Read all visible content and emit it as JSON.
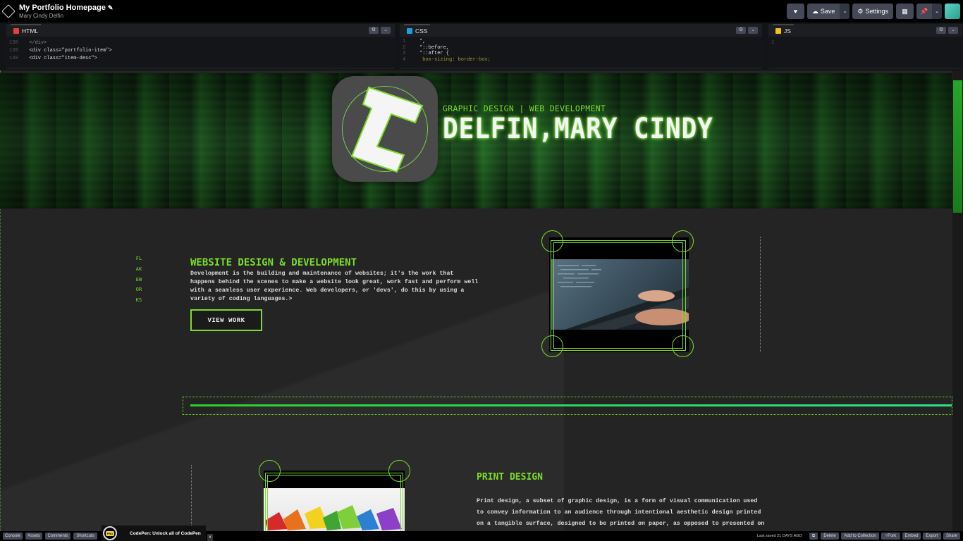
{
  "header": {
    "pen_title": "My Portfolio Homepage",
    "edit_icon": "pencil-icon",
    "author": "Mary Cindy Delfin",
    "buttons": {
      "heart_icon": "heart-icon",
      "save": "Save",
      "settings": "Settings"
    }
  },
  "editors": {
    "html": {
      "label": "HTML",
      "color": "#e5413a",
      "lines": [
        {
          "num": "138",
          "code": "      </div>"
        },
        {
          "num": "139",
          "code": "      <div class=\"portfolio-item\">"
        },
        {
          "num": "140",
          "code": "        <div class=\"item-desc\">"
        }
      ]
    },
    "css": {
      "label": "CSS",
      "color": "#1aa0e0",
      "lines": [
        {
          "num": "1",
          "code": "*,"
        },
        {
          "num": "2",
          "code": "*::before,"
        },
        {
          "num": "3",
          "code": "*::after {"
        },
        {
          "num": "4",
          "code": "  box-sizing: border-box;"
        }
      ]
    },
    "js": {
      "label": "JS",
      "color": "#f2c21b",
      "lines": [
        {
          "num": "1",
          "code": ""
        }
      ]
    }
  },
  "preview": {
    "subtitle": "GRAPHIC DESIGN | WEB DEVELOPMENT",
    "name": "DELFIN,MARY CINDY",
    "side_label": "FLAKEWORKS",
    "section1": {
      "title": "WEBSITE DESIGN & DEVELOPMENT",
      "body": "Development is the building and maintenance of websites; it's the work that happens behind the scenes to make a website look great, work fast and perform well with a seamless user experience. Web developers, or 'devs', do this by using a variety of coding languages.>",
      "button": "VIEW WORK"
    },
    "section2": {
      "title": "PRINT DESIGN",
      "body": "Print design, a subset of graphic design, is a form of visual communication used to convey information to an audience through intentional aesthetic design printed on a tangible surface, designed to be printed on paper, as opposed to presented on a"
    },
    "accent_color": "#7bdc2a"
  },
  "footer": {
    "left_buttons": [
      "Console",
      "Assets",
      "Comments",
      "Shortcuts"
    ],
    "promo": "CodePen: Unlock all of CodePen",
    "promo_badge": "PRO",
    "close": "x",
    "last_saved": "Last saved 21 DAYS AGO",
    "right_buttons": [
      "Delete",
      "Add to Collection",
      "Fork",
      "Embed",
      "Export",
      "Share"
    ]
  }
}
